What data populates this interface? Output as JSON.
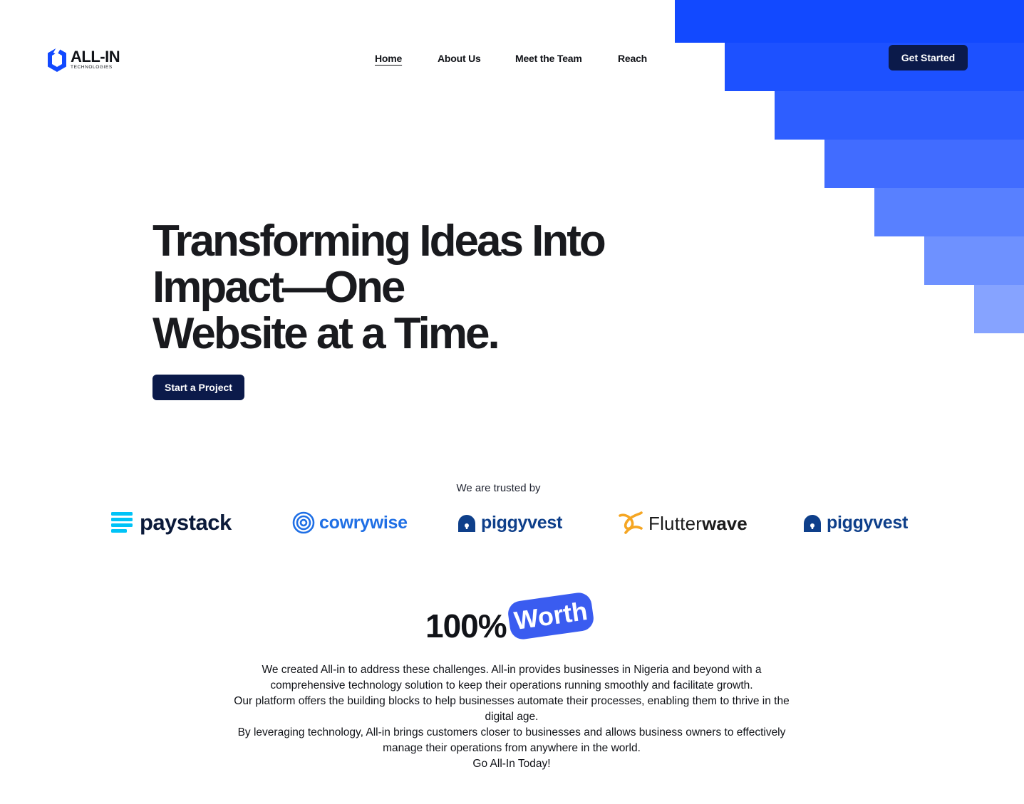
{
  "brand": {
    "name": "ALL-IN",
    "tagline": "TECHNOLOGIES"
  },
  "nav": {
    "items": [
      {
        "label": "Home",
        "active": true
      },
      {
        "label": "About Us",
        "active": false
      },
      {
        "label": "Meet the Team",
        "active": false
      },
      {
        "label": "Reach",
        "active": false
      }
    ],
    "cta": "Get Started"
  },
  "hero": {
    "title_lines": [
      "Transforming Ideas Into",
      "Impact—One",
      "Website at a Time."
    ],
    "cta": "Start a Project"
  },
  "trusted": {
    "label": "We are trusted by",
    "logos": [
      {
        "name": "paystack",
        "icon": "paystack-logo-icon"
      },
      {
        "name": "cowrywise",
        "icon": "cowrywise-logo-icon"
      },
      {
        "name": "piggyvest",
        "icon": "piggyvest-logo-icon"
      },
      {
        "name": "Flutter",
        "name_bold": "wave",
        "icon": "flutterwave-logo-icon"
      },
      {
        "name": "piggyvest",
        "icon": "piggyvest-logo-icon"
      }
    ]
  },
  "worth": {
    "stat": "100%",
    "badge": "Worth",
    "paragraphs": [
      "We created All-in to address these challenges. All-in provides businesses in Nigeria and beyond with a comprehensive technology solution to keep their operations running smoothly and facilitate growth.",
      "Our platform offers the building blocks to help businesses automate their processes, enabling them to thrive in the digital age.",
      "By leveraging technology, All-in brings customers closer to businesses and allows business owners to effectively manage their operations from anywhere in the world.",
      "Go All-In Today!"
    ]
  },
  "colors": {
    "accent": "#1249ff",
    "navy_button": "#0b1a4a",
    "badge": "#3a5cf0",
    "text": "#111318"
  }
}
